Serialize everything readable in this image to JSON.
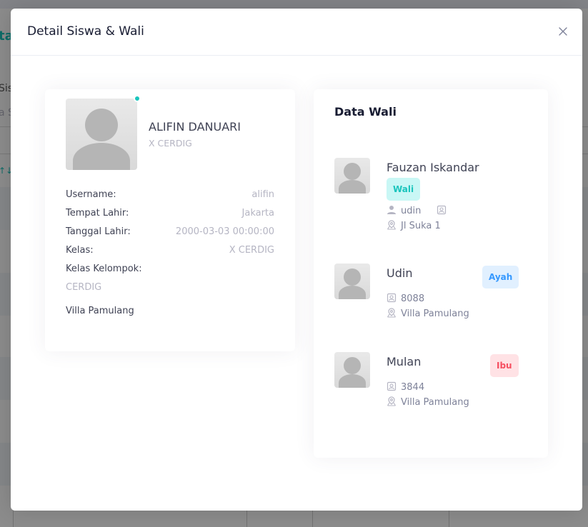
{
  "background": {
    "title_fragment": "ta",
    "label_fragment": "Sis",
    "placeholder_fragment": "a S",
    "sort_fragment": "↑↓"
  },
  "modal": {
    "title": "Detail Siswa & Wali",
    "close_icon": "close-icon"
  },
  "student": {
    "name": "ALIFIN DANUARI",
    "class": "X CERDIG",
    "online_color": "#1bc5bd",
    "fields": [
      {
        "label": "Username:",
        "value": "alifin"
      },
      {
        "label": "Tempat Lahir:",
        "value": "Jakarta"
      },
      {
        "label": "Tanggal Lahir:",
        "value": "2000-03-03 00:00:00"
      },
      {
        "label": "Kelas:",
        "value": "X CERDIG"
      },
      {
        "label": "Kelas Kelompok:",
        "value": ""
      }
    ],
    "kelas_kelompok_value": "CERDIG",
    "address": "Villa Pamulang"
  },
  "wali": {
    "title": "Data Wali",
    "guardians": [
      {
        "name": "Fauzan Iskandar",
        "badge": "Wali",
        "username": "udin",
        "address": "Jl Suka 1"
      },
      {
        "name": "Udin",
        "badge": "Ayah",
        "id": "8088",
        "address": "Villa Pamulang"
      },
      {
        "name": "Mulan",
        "badge": "Ibu",
        "id": "3844",
        "address": "Villa Pamulang"
      }
    ]
  }
}
